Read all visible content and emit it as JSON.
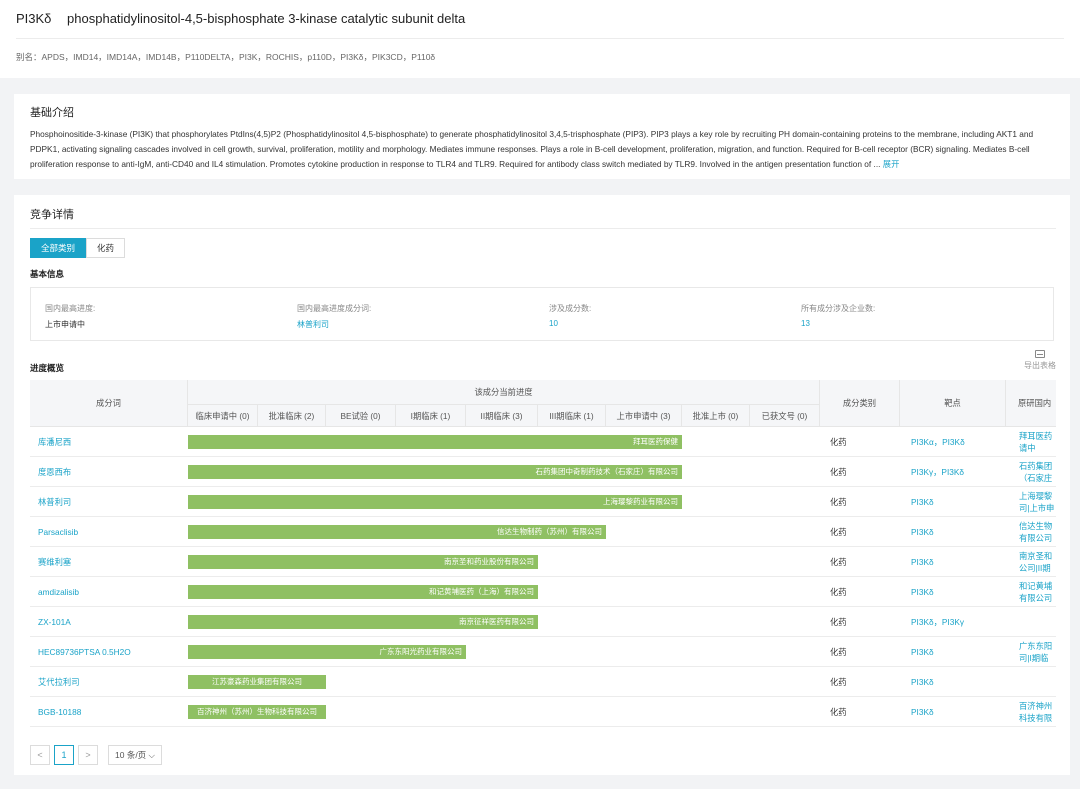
{
  "header": {
    "symbol": "PI3Kδ",
    "name": "phosphatidylinositol-4,5-bisphosphate 3-kinase catalytic subunit delta",
    "alias": "别名：APDS，IMD14，IMD14A，IMD14B，P110DELTA，PI3K，ROCHIS，p110D，PI3Kδ，PIK3CD，P110δ"
  },
  "intro": {
    "title": "基础介绍",
    "text": "Phosphoinositide-3-kinase (PI3K) that phosphorylates PtdIns(4,5)P2 (Phosphatidylinositol 4,5-bisphosphate) to generate phosphatidylinositol 3,4,5-trisphosphate (PIP3). PIP3 plays a key role by recruiting PH domain-containing proteins to the membrane, including AKT1 and PDPK1, activating signaling cascades involved in cell growth, survival, proliferation, motility and morphology. Mediates immune responses. Plays a role in B-cell development, proliferation, migration, and function. Required for B-cell receptor (BCR) signaling. Mediates B-cell proliferation response to anti-IgM, anti-CD40 and IL4 stimulation. Promotes cytokine production in response to TLR4 and TLR9. Required for antibody class switch mediated by TLR9. Involved in the antigen presentation function of ...",
    "expand": "展开"
  },
  "competition": {
    "title": "竞争详情",
    "tabs": [
      "全部类别",
      "化药"
    ],
    "basic_title": "基本信息",
    "basic": [
      {
        "label": "国内最高进度:",
        "value": "上市申请中"
      },
      {
        "label": "国内最高进度成分词:",
        "value": "林普利司"
      },
      {
        "label": "涉及成分数:",
        "value": "10"
      },
      {
        "label": "所有成分涉及企业数:",
        "value": "13"
      }
    ],
    "progress_title": "进度概览",
    "export_label": "导出表格"
  },
  "table": {
    "col_component": "成分词",
    "col_progress": "该成分当前进度",
    "stages": [
      "临床申请中 (0)",
      "批准临床 (2)",
      "BE试验 (0)",
      "I期临床 (1)",
      "II期临床 (3)",
      "III期临床 (1)",
      "上市申请中 (3)",
      "批准上市 (0)",
      "已获文号 (0)"
    ],
    "col_category": "成分类别",
    "col_target": "靶点",
    "col_org": "原研国内",
    "rows": [
      {
        "name": "库潘尼西",
        "company": "拜耳医药保健",
        "stage_index": 6,
        "category": "化药",
        "targets": "PI3Kα，PI3Kδ",
        "org1": "拜耳医药",
        "org2": "请中"
      },
      {
        "name": "度恩西布",
        "company": "石药集团中奇制药技术（石家庄）有限公司",
        "stage_index": 6,
        "category": "化药",
        "targets": "PI3Kγ，PI3Kδ",
        "org1": "石药集团",
        "org2": "（石家庄"
      },
      {
        "name": "林普利司",
        "company": "上海璎黎药业有限公司",
        "stage_index": 6,
        "category": "化药",
        "targets": "PI3Kδ",
        "org1": "上海璎黎",
        "org2": "司|上市申"
      },
      {
        "name": "Parsaclisib",
        "company": "信达生物制药（苏州）有限公司",
        "stage_index": 5,
        "category": "化药",
        "targets": "PI3Kδ",
        "org1": "信达生物",
        "org2": "有限公司"
      },
      {
        "name": "赛维利塞",
        "company": "南京圣和药业股份有限公司",
        "stage_index": 4,
        "category": "化药",
        "targets": "PI3Kδ",
        "org1": "南京圣和",
        "org2": "公司|II期"
      },
      {
        "name": "amdizalisib",
        "company": "和记黄埔医药（上海）有限公司",
        "stage_index": 4,
        "category": "化药",
        "targets": "PI3Kδ",
        "org1": "和记黄埔",
        "org2": "有限公司"
      },
      {
        "name": "ZX-101A",
        "company": "南京征祥医药有限公司",
        "stage_index": 4,
        "category": "化药",
        "targets": "PI3Kδ，PI3Kγ",
        "org1": "",
        "org2": ""
      },
      {
        "name": "HEC89736PTSA 0.5H2O",
        "company": "广东东阳光药业有限公司",
        "stage_index": 3,
        "category": "化药",
        "targets": "PI3Kδ",
        "org1": "广东东阳",
        "org2": "司|I期临"
      },
      {
        "name": "艾代拉利司",
        "company": "江苏豪森药业集团有限公司",
        "stage_index": 1,
        "category": "化药",
        "targets": "PI3Kδ",
        "org1": "",
        "org2": ""
      },
      {
        "name": "BGB-10188",
        "company": "百济神州（苏州）生物科技有限公司",
        "stage_index": 1,
        "category": "化药",
        "targets": "PI3Kδ",
        "org1": "百济神州",
        "org2": "科技有限"
      }
    ]
  },
  "pager": {
    "prev": "<",
    "page": "1",
    "next": ">",
    "size": "10 条/页"
  },
  "colors": {
    "accent": "#1aa3c8",
    "bar": "#8fc063"
  }
}
